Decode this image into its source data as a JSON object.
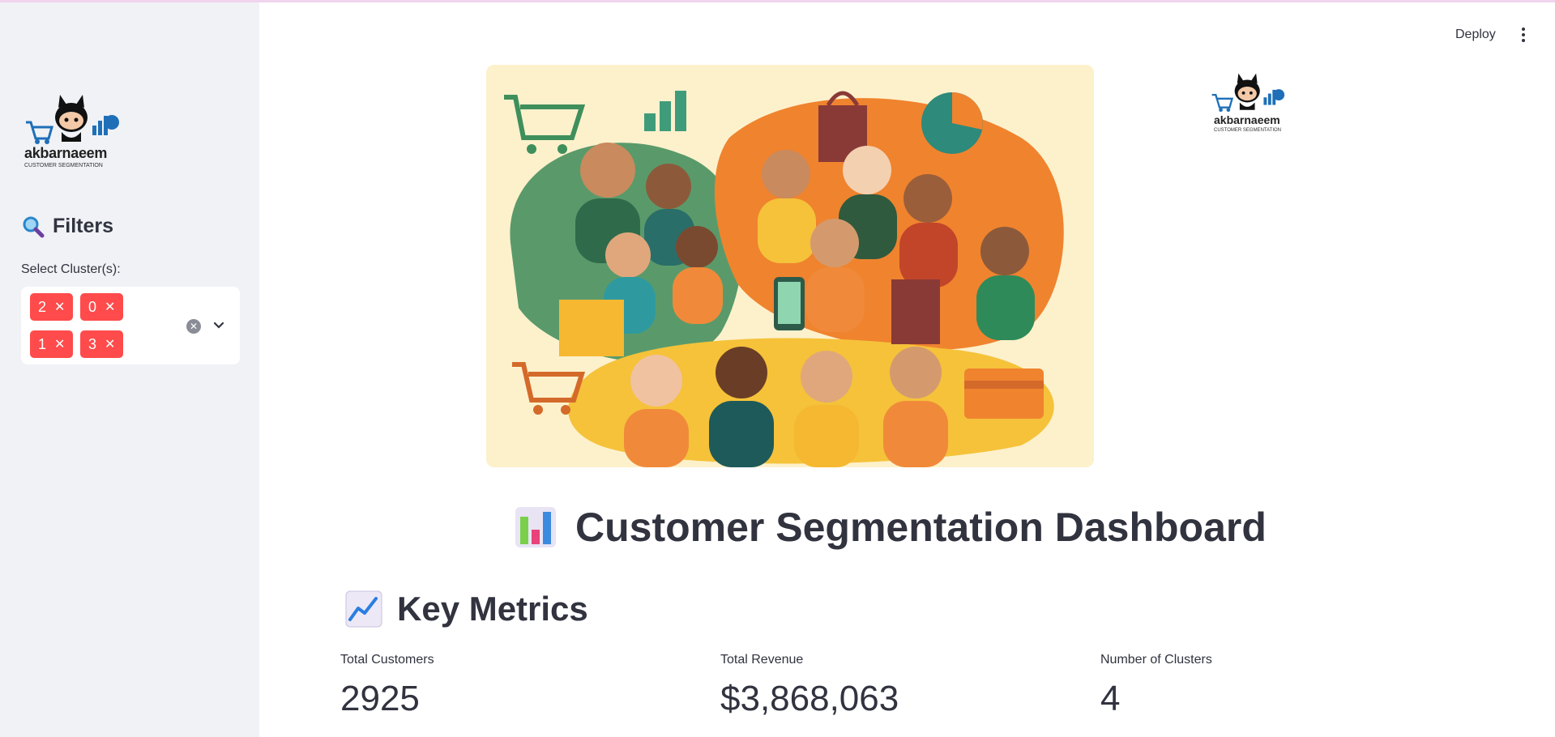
{
  "sidebar": {
    "logo": {
      "name": "akbarnaeem",
      "tagline": "CUSTOMER SEGMENTATION"
    },
    "filters_heading": "Filters",
    "select_label": "Select Cluster(s):",
    "selected_clusters": [
      "2",
      "0",
      "1",
      "3"
    ]
  },
  "header": {
    "deploy_label": "Deploy"
  },
  "right_logo": {
    "name": "akbarnaeem",
    "tagline": "CUSTOMER SEGMENTATION"
  },
  "main": {
    "title": "Customer Segmentation Dashboard",
    "key_metrics_heading": "Key Metrics",
    "metrics": [
      {
        "label": "Total Customers",
        "value": "2925"
      },
      {
        "label": "Total Revenue",
        "value": "$3,868,063"
      },
      {
        "label": "Number of Clusters",
        "value": "4"
      }
    ]
  },
  "colors": {
    "chip": "#ff4b4b",
    "sidebar_bg": "#f0f2f6",
    "hero_bg": "#fdf1cc",
    "text": "#31333f"
  }
}
